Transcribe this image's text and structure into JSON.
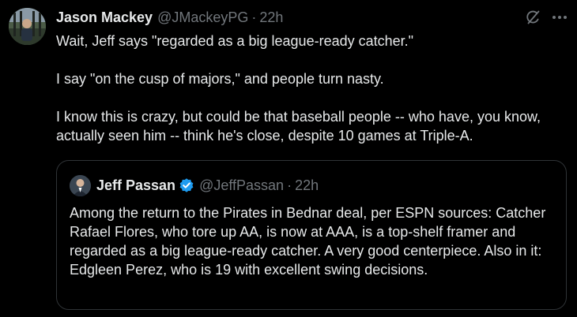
{
  "tweet": {
    "display_name": "Jason Mackey",
    "handle": "@JMackeyPG",
    "separator": "·",
    "time": "22h",
    "paragraphs": [
      "Wait, Jeff says \"regarded as a big league-ready catcher.\"",
      "I say \"on the cusp of majors,\" and people turn nasty.",
      "I know this is crazy, but could be that baseball people -- who have, you know, actually seen him -- think he's close, despite 10 games at Triple-A."
    ],
    "icons": [
      "grok-icon",
      "more-icon"
    ]
  },
  "quote": {
    "display_name": "Jeff Passan",
    "verified": true,
    "handle": "@JeffPassan",
    "separator": "·",
    "time": "22h",
    "text": "Among the return to the Pirates in Bednar deal, per ESPN sources: Catcher Rafael Flores, who tore up AA, is now at AAA, is a top-shelf framer and regarded as a big league-ready catcher. A very good centerpiece. Also in it: Edgleen Perez, who is 19 with excellent swing decisions."
  },
  "colors": {
    "background": "#000000",
    "text_primary": "#e7e9ea",
    "text_secondary": "#71767b",
    "border": "#2f3336",
    "verified_blue": "#1d9bf0"
  }
}
